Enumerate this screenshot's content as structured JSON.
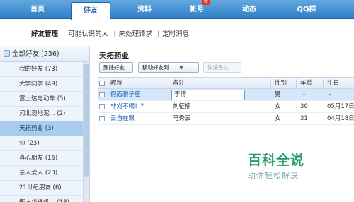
{
  "nav": {
    "tabs": [
      {
        "label": "首页"
      },
      {
        "label": "好友"
      },
      {
        "label": "资料"
      },
      {
        "label": "帐号"
      },
      {
        "label": "动态"
      },
      {
        "label": "QQ群"
      }
    ],
    "active_tab": "好友",
    "badge": "新"
  },
  "subnav": {
    "items": [
      "好友管理",
      "可能认识的人",
      "未处理请求",
      "定时消息"
    ]
  },
  "sidebar": {
    "header": "全部好友 (236)",
    "items": [
      "我的好友 (73)",
      "大学同学 (49)",
      "富士达电动车 (5)",
      "河北澳地泥... (2)",
      "天拓药业 (3)",
      "帅 (23)",
      "真心朋友 (16)",
      "亲人爱人 (23)",
      "21世纪朋友 (6)",
      "衡水华通机... (18)"
    ],
    "selected": "天拓药业 (3)"
  },
  "main": {
    "group_title": "天拓药业",
    "buttons": {
      "delete": "删除好友",
      "move": "移动好友到...",
      "quick_remark": "快速备注"
    },
    "columns": [
      "昵称",
      "备注",
      "性别",
      "年龄",
      "生日"
    ],
    "rows": [
      {
        "nick": "假面驸子座",
        "remark": "李博",
        "gender": "男",
        "age": "-",
        "birthday": "-"
      },
      {
        "nick": "非刈不喝！？",
        "remark": "刘征楠",
        "gender": "女",
        "age": "30",
        "birthday": "05月17日"
      },
      {
        "nick": "云自在飘",
        "remark": "马秀云",
        "gender": "女",
        "age": "31",
        "birthday": "04月18日"
      }
    ]
  },
  "watermark": {
    "title": "百科全说",
    "subtitle": "助你轻松解决"
  },
  "colors": {
    "nav_blue": "#2f7ec6",
    "selected_row": "#a9cbee",
    "link": "#1a5db0",
    "watermark": "#2c9a6b"
  }
}
